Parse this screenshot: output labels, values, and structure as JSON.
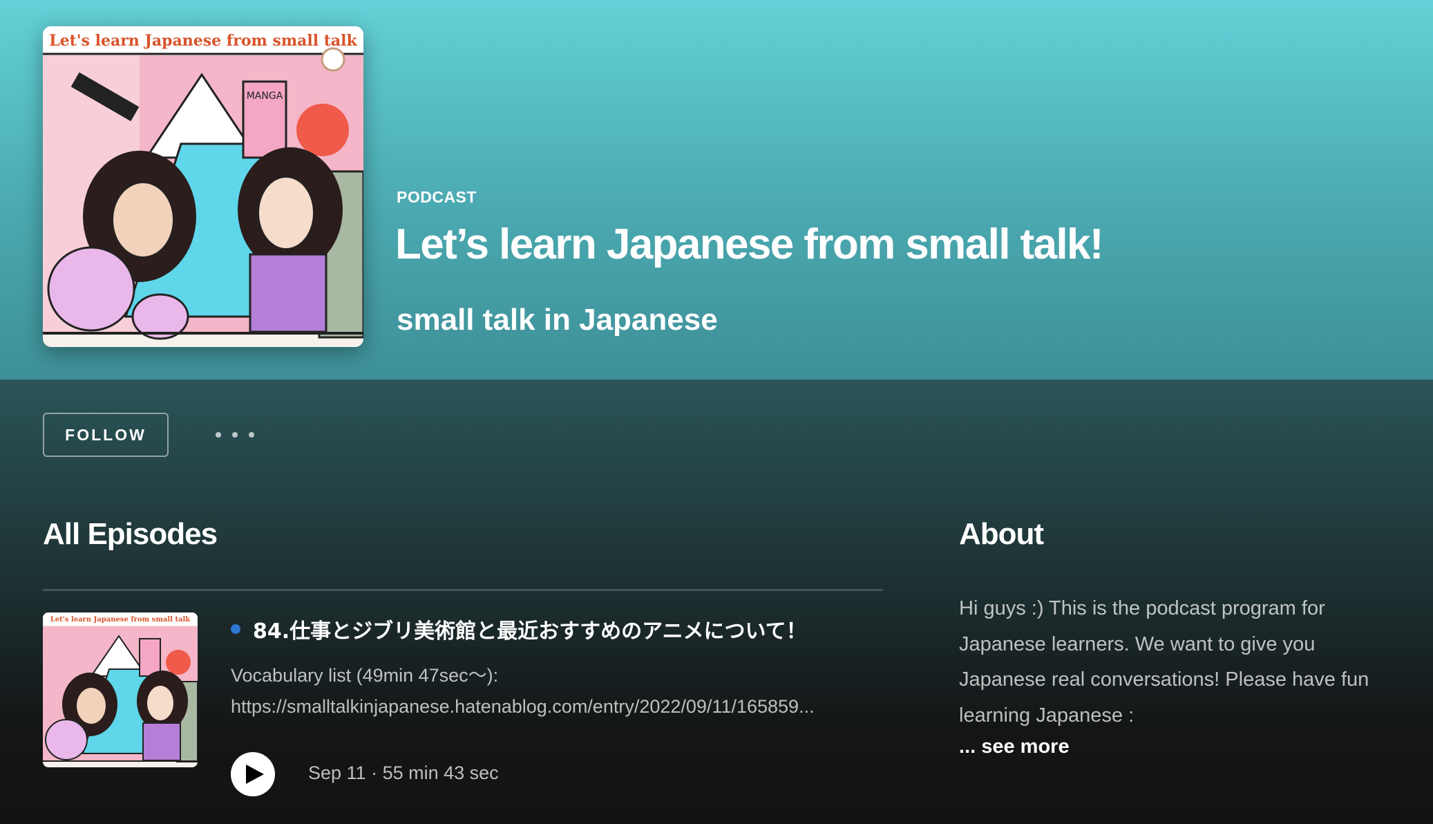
{
  "podcast": {
    "type_label": "PODCAST",
    "title": "Let’s learn Japanese from small talk!",
    "publisher": "small talk in Japanese",
    "cover_title": "Let's learn Japanese from small talk",
    "cover_manga_label": "MANGA"
  },
  "actions": {
    "follow_label": "FOLLOW",
    "more_icon": "more-horizontal-icon"
  },
  "episodes_section": {
    "heading": "All Episodes",
    "episodes": [
      {
        "title": "84.仕事とジブリ美術館と最近おすすめのアニメについて！",
        "unplayed": true,
        "description_line1": "Vocabulary list (49min 47sec〜):",
        "description_line2": "https://smalltalkinjapanese.hatenablog.com/entry/2022/09/11/165859...",
        "meta": "Sep 11 · 55 min 43 sec",
        "play_icon": "play-icon"
      }
    ]
  },
  "about_section": {
    "heading": "About",
    "text": "Hi guys :) This is the podcast program for Japanese learners. We want to give you Japanese real conversations! Please have fun learning Japanese :",
    "see_more_label": "... see more"
  },
  "colors": {
    "hero_top": "#63d1d7",
    "hero_bottom": "#3e8f97",
    "background": "#121212",
    "unplayed_dot": "#2e77d0"
  }
}
